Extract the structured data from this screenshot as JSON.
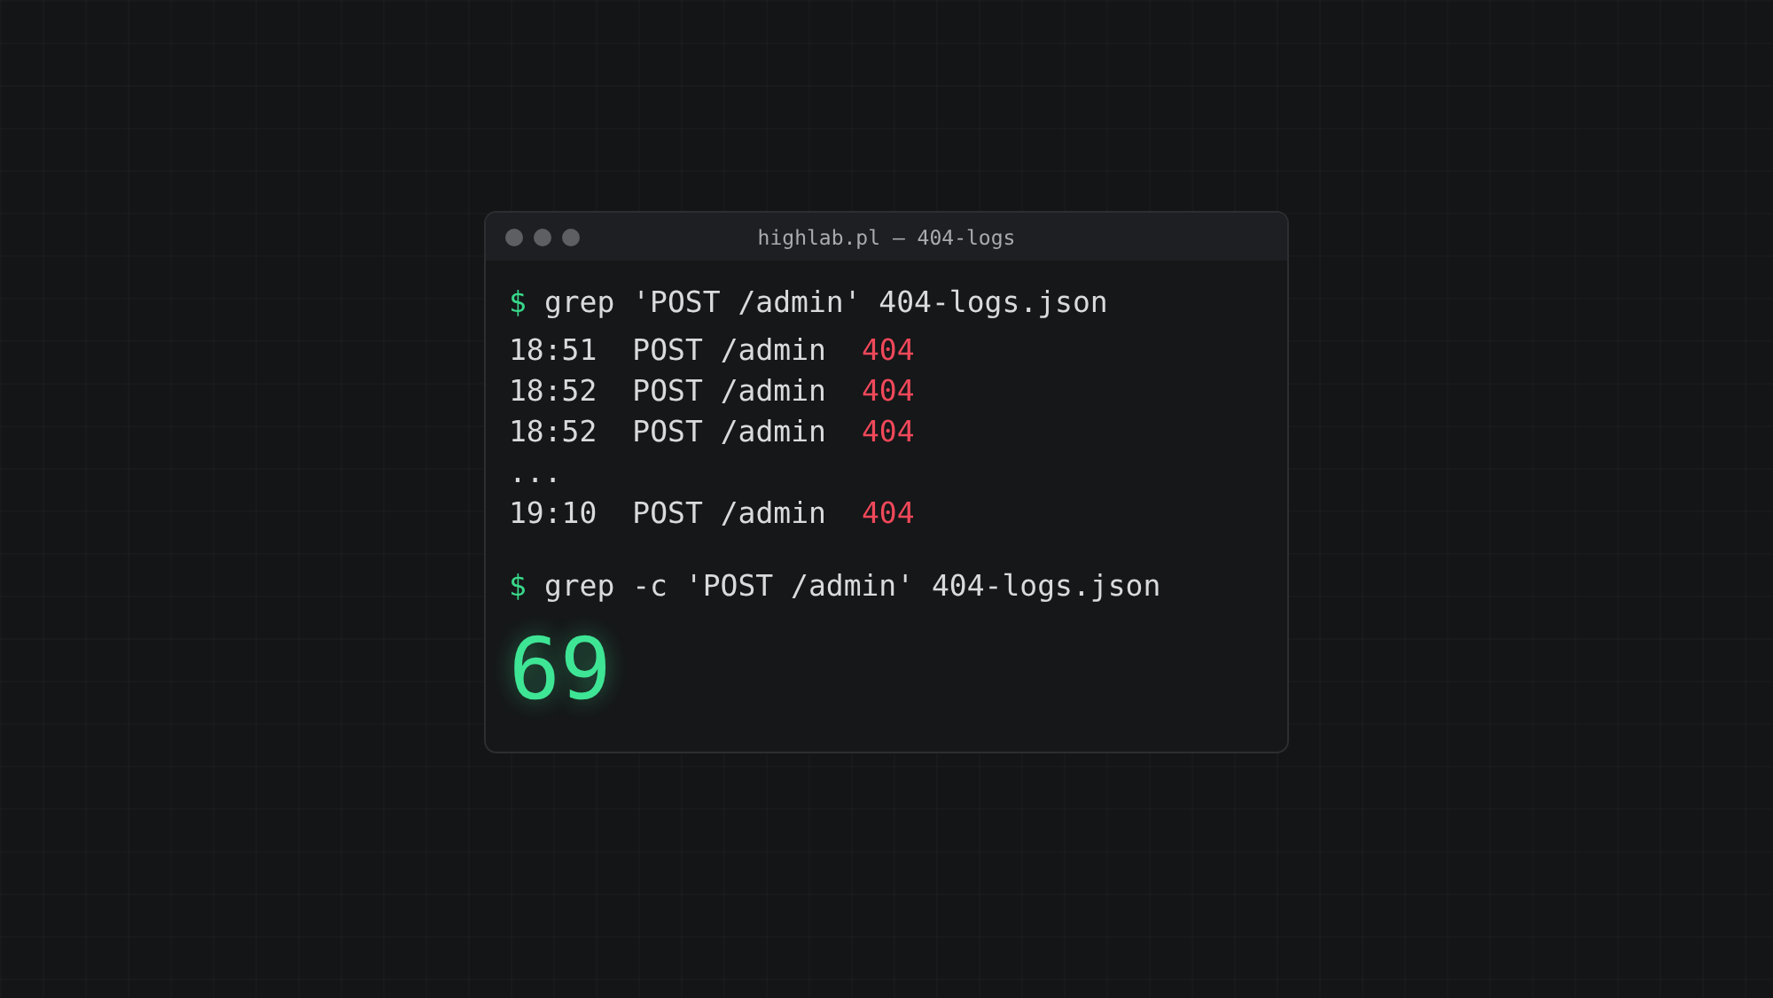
{
  "window": {
    "title": "highlab.pl – 404-logs"
  },
  "lines": [
    {
      "kind": "command",
      "prompt": "$",
      "text": "grep 'POST /admin' 404-logs.json"
    },
    {
      "kind": "log",
      "time": "18:51",
      "request": "POST /admin",
      "status": "404"
    },
    {
      "kind": "log",
      "time": "18:52",
      "request": "POST /admin",
      "status": "404"
    },
    {
      "kind": "log",
      "time": "18:52",
      "request": "POST /admin",
      "status": "404"
    },
    {
      "kind": "ellipsis",
      "text": "..."
    },
    {
      "kind": "log",
      "time": "19:10",
      "request": "POST /admin",
      "status": "404"
    },
    {
      "kind": "command",
      "prompt": "$",
      "text": "grep -c 'POST /admin' 404-logs.json"
    },
    {
      "kind": "result",
      "text": "69"
    }
  ]
}
